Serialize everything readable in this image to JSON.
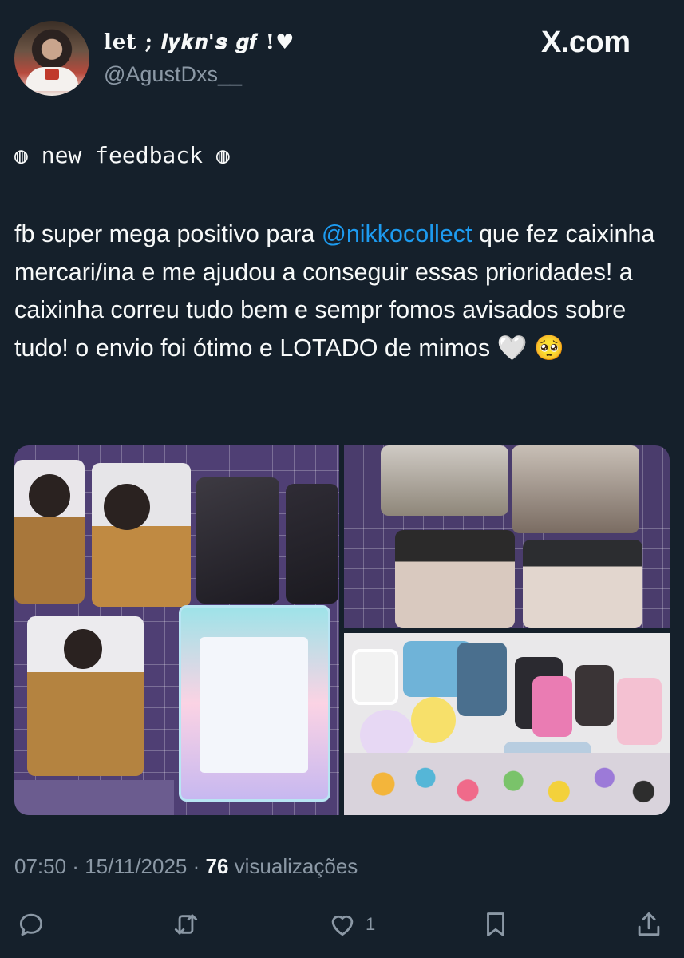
{
  "colors": {
    "background": "#15202b",
    "text": "#f7f9f9",
    "muted": "#8b98a5",
    "mention": "#1d9bf0"
  },
  "author": {
    "display_name": "let ; 𝒍𝒚𝒌𝒏'𝒔 𝒈𝒇 !♥",
    "handle": "@AgustDxs__",
    "avatar_icon": "profile-avatar"
  },
  "brand": {
    "label": "X.com",
    "icon": "x-logo"
  },
  "post": {
    "feedback_line": "◍ new feedback ◍",
    "text_before_mention": "fb super mega positivo para ",
    "mention": "@nikkocollect",
    "text_after_mention": " que fez caixinha mercari/ina e me ajudou a conseguir essas prioridades! a caixinha correu tudo bem e sempr fomos avisados sobre tudo! o envio foi ótimo e LOTADO de mimos 🤍 🥺"
  },
  "media": {
    "photos": [
      {
        "icon": "photocards-photo"
      },
      {
        "icon": "photocards-closeup-photo"
      },
      {
        "icon": "stickers-freebies-photo"
      }
    ]
  },
  "meta": {
    "time": "07:50",
    "separator": " · ",
    "date": "15/11/2025",
    "views_count": "76",
    "views_label": "visualizações"
  },
  "actions": {
    "reply_icon": "reply-icon",
    "repost_icon": "repost-icon",
    "like_icon": "like-icon",
    "like_count": "1",
    "bookmark_icon": "bookmark-icon",
    "share_icon": "share-icon"
  }
}
